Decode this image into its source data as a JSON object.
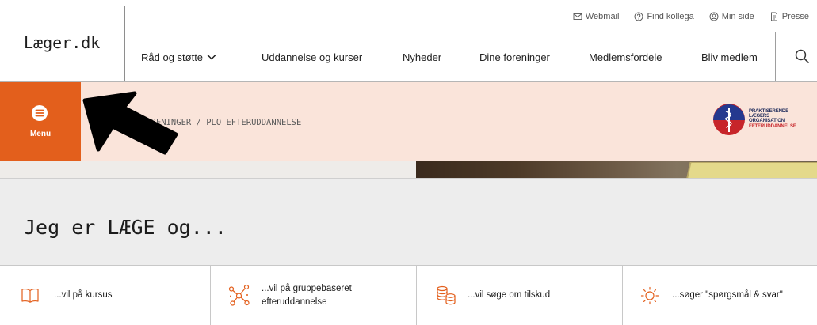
{
  "colors": {
    "accent": "#E35F1C",
    "subheader_bg": "#FAE4DA",
    "hero_bg": "#EDEDED",
    "text": "#222222",
    "org_navy": "#1D2A5A",
    "org_red": "#C7252A"
  },
  "header": {
    "logo": "Læger.dk",
    "utility_links": [
      {
        "label": "Webmail",
        "icon": "envelope-icon"
      },
      {
        "label": "Find kollega",
        "icon": "question-circle-icon"
      },
      {
        "label": "Min side",
        "icon": "user-circle-icon"
      },
      {
        "label": "Presse",
        "icon": "press-icon"
      }
    ],
    "nav": [
      {
        "label": "Råd og støtte",
        "icon": "chevron-down-icon"
      },
      {
        "label": "Uddannelse og kurser"
      },
      {
        "label": "Nyheder"
      },
      {
        "label": "Dine foreninger"
      },
      {
        "label": "Medlemsfordele"
      },
      {
        "label": "Bliv medlem"
      }
    ],
    "search_icon": "search-icon"
  },
  "subheader": {
    "menu": {
      "label": "Menu",
      "icon": "hamburger-circle-icon"
    },
    "breadcrumb": {
      "items": [
        "FORENINGER",
        "PLO EFTERUDDANNELSE"
      ],
      "separator": "/"
    },
    "org_logo": {
      "icon": "plo-emblem-icon",
      "lines": [
        "PRAKTISERENDE",
        "LÆGERS",
        "ORGANISATION",
        "EFTERUDDANNELSE"
      ]
    },
    "annotation_icon": "pointer-arrow-icon"
  },
  "hero": {
    "heading": "Jeg er LÆGE og..."
  },
  "cards": [
    {
      "icon": "book-icon",
      "label_lines": [
        "...vil på kursus"
      ]
    },
    {
      "icon": "network-icon",
      "label_lines": [
        "...vil på gruppebaseret",
        "efteruddannelse"
      ]
    },
    {
      "icon": "coins-icon",
      "label_lines": [
        "...vil søge om tilskud"
      ]
    },
    {
      "icon": "sun-icon",
      "label_lines": [
        "...søger \"spørgsmål & svar\""
      ]
    }
  ]
}
